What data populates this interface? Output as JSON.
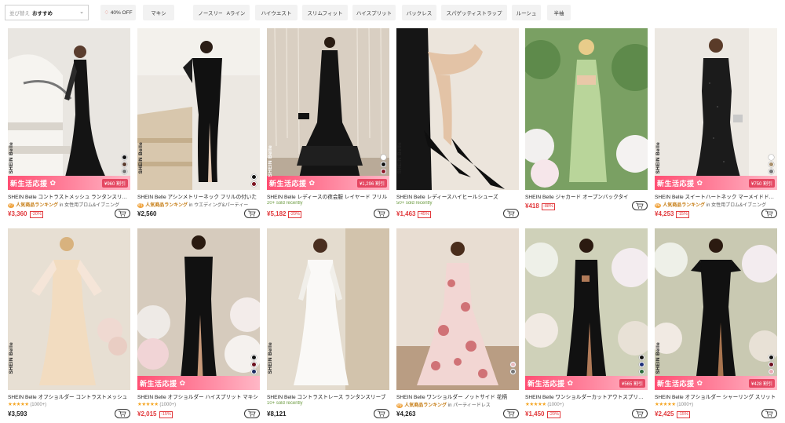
{
  "filter_bar": {
    "sort": {
      "label": "並び替え",
      "value": "おすすめ"
    },
    "chips": [
      "40% OFF",
      "マキシ",
      "ノースリーブ",
      "Aライン",
      "ハイウエスト",
      "スリムフィット",
      "ハイスプリット",
      "バックレス",
      "スパゲッティストラップ",
      "ルーシュ",
      "半袖"
    ]
  },
  "promo_badge": "新生活応援",
  "products": [
    {
      "name": "SHEIN Belle コントラストメッシュ ランタンスリーブ マーメイド",
      "rank_badge": "#7",
      "rank": "人気商品ランキング",
      "rank_cat": "in 女性用プロム&イブニング",
      "price": "¥3,360",
      "discount": "-20%",
      "promo_price": "¥960 割引",
      "brand": "SHEIN Belle"
    },
    {
      "name": "SHEIN Belle アシンメトリーネック フリルの付いた",
      "rank_badge": "#1",
      "rank": "人気商品ランキング",
      "rank_cat": "in ウエディング&パーティー",
      "price": "¥2,560",
      "brand": "SHEIN Belle"
    },
    {
      "name": "SHEIN Belle レディースの夜会服 レイヤード フリル",
      "sold": "20+ sold recently",
      "price": "¥5,182",
      "discount": "-20%",
      "promo_price": "¥1,296 割引",
      "brand": "SHEIN Belle"
    },
    {
      "name": "SHEIN Belle レディースハイヒールシューズ",
      "sold": "50+ sold recently",
      "price": "¥1,463",
      "discount": "-45%",
      "brand": "SHEIN Belle"
    },
    {
      "name": "SHEIN Belle ジャカード オープンバックタイ",
      "price": "¥418",
      "discount": "-88%"
    },
    {
      "name": "SHEIN Belle スイートハートネック マーメイドドレス",
      "rank_badge": "#4",
      "rank": "人気商品ランキング",
      "rank_cat": "in 女性用プロム&イブニング",
      "price": "¥4,253",
      "discount": "-15%",
      "promo_price": "¥750 割引",
      "brand": "SHEIN Belle"
    },
    {
      "name": "SHEIN Belle オフショルダー コントラストメッシュ",
      "stars": "★★★★★",
      "reviews": "(1000+)",
      "price": "¥3,593",
      "brand": "SHEIN Belle"
    },
    {
      "name": "SHEIN Belle オフショルダー ハイスプリット マキシ",
      "stars": "★★★★★",
      "reviews": "(1000+)",
      "price": "¥2,015",
      "discount": "-15%"
    },
    {
      "name": "SHEIN Belle コントラストレース ランタンスリーブ",
      "sold": "10+ sold recently",
      "price": "¥8,121",
      "brand": "SHEIN Belle"
    },
    {
      "name": "SHEIN Belle ワンショルダー ノットサイド 花柄",
      "rank_badge": "#9",
      "rank": "人気商品ランキング",
      "rank_cat": "in パーティードレス",
      "price": "¥4,263"
    },
    {
      "name": "SHEIN Belle ワンショルダーカットアウトスプリット",
      "stars": "★★★★★",
      "reviews": "(1000+)",
      "price": "¥1,450",
      "discount": "-20%",
      "promo_price": "¥565 割引"
    },
    {
      "name": "SHEIN Belle オフショルダー シャーリング スリット",
      "stars": "★★★★★",
      "reviews": "(1000+)",
      "price": "¥2,425",
      "discount": "-15%",
      "promo_price": "¥428 割引",
      "brand": "SHEIN Belle"
    }
  ],
  "colors": {
    "sale_red": "#e1393c",
    "promo_pink": "#ff4f73",
    "rank_orange": "#c57b12",
    "sold_green": "#6a9a3e",
    "star": "#f5a623"
  },
  "icons": {
    "cart": "add-to-cart-icon",
    "tag": "discount-tag-icon",
    "chevron": "chevron-down-icon"
  }
}
